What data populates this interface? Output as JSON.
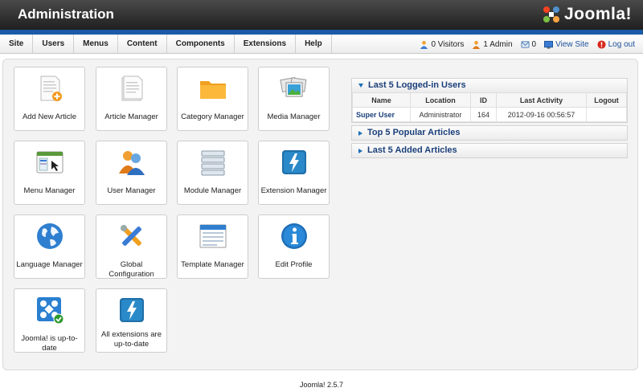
{
  "header": {
    "title": "Administration",
    "logo_text": "Joomla!"
  },
  "menu": [
    "Site",
    "Users",
    "Menus",
    "Content",
    "Components",
    "Extensions",
    "Help"
  ],
  "status": {
    "visitors": "0 Visitors",
    "admins": "1 Admin",
    "messages": "0",
    "view_site": "View Site",
    "logout": "Log out"
  },
  "tiles": [
    {
      "label": "Add New Article",
      "icon": "add-article-icon"
    },
    {
      "label": "Article Manager",
      "icon": "article-manager-icon"
    },
    {
      "label": "Category Manager",
      "icon": "folder-icon"
    },
    {
      "label": "Media Manager",
      "icon": "media-icon"
    },
    {
      "label": "Menu Manager",
      "icon": "menu-icon"
    },
    {
      "label": "User Manager",
      "icon": "users-icon"
    },
    {
      "label": "Module Manager",
      "icon": "module-icon"
    },
    {
      "label": "Extension Manager",
      "icon": "extension-icon"
    },
    {
      "label": "Language Manager",
      "icon": "globe-icon"
    },
    {
      "label": "Global Configuration",
      "icon": "tools-icon"
    },
    {
      "label": "Template Manager",
      "icon": "template-icon"
    },
    {
      "label": "Edit Profile",
      "icon": "info-icon"
    },
    {
      "label": "Joomla! is up-to-date",
      "icon": "joomla-update-icon"
    },
    {
      "label": "All extensions are up-to-date",
      "icon": "extension-update-icon"
    }
  ],
  "modules": {
    "logged_in": {
      "title": "Last 5 Logged-in Users",
      "columns": [
        "Name",
        "Location",
        "ID",
        "Last Activity",
        "Logout"
      ],
      "rows": [
        {
          "name": "Super User",
          "location": "Administrator",
          "id": "164",
          "last_activity": "2012-09-16 00:56:57",
          "logout": ""
        }
      ]
    },
    "popular": {
      "title": "Top 5 Popular Articles"
    },
    "added": {
      "title": "Last 5 Added Articles"
    }
  },
  "footer": {
    "version": "Joomla! 2.5.7"
  },
  "colors": {
    "accent_blue": "#1b5aa6",
    "link": "#1a4f9a",
    "header_dark": "#1f1f1f"
  }
}
